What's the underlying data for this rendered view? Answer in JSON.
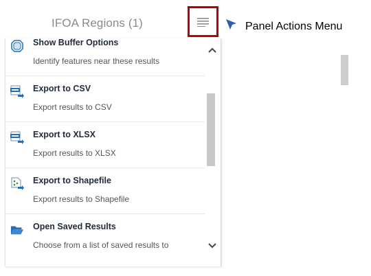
{
  "panel": {
    "title": "IFOA Regions (1)"
  },
  "annotation": {
    "label": "Panel Actions Menu"
  },
  "menu": {
    "items": [
      {
        "title": "Show Buffer Options",
        "subtitle": "Identify features near these results",
        "icon": "buffer-icon"
      },
      {
        "title": "Export to CSV",
        "subtitle": "Export results to CSV",
        "icon": "csv-export-icon"
      },
      {
        "title": "Export to XLSX",
        "subtitle": "Export results to XLSX",
        "icon": "xlsx-export-icon"
      },
      {
        "title": "Export to Shapefile",
        "subtitle": "Export results to Shapefile",
        "icon": "shapefile-export-icon"
      },
      {
        "title": "Open Saved Results",
        "subtitle": "Choose from a list of saved results to",
        "icon": "folder-open-icon"
      }
    ]
  },
  "colors": {
    "highlight_border": "#c00000",
    "arrow": "#2f5fa8",
    "title_text": "#1f2a3a",
    "subtitle_text": "#555555",
    "icon_blue": "#1f6fb5"
  }
}
